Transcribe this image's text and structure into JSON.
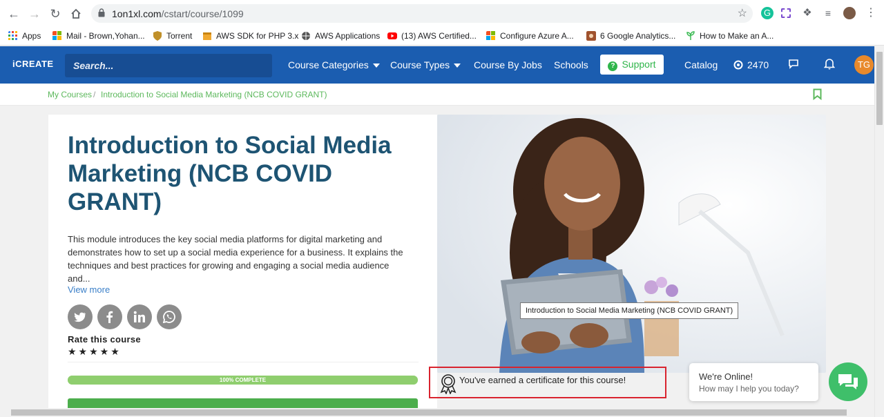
{
  "browser": {
    "url_host": "1on1xl.com",
    "url_path": "/cstart/course/1099",
    "bookmarks": [
      {
        "label": "Apps",
        "icon": "apps-grid-icon",
        "color": "#4285f4"
      },
      {
        "label": "Mail - Brown,Yohan...",
        "icon": "windows-icon",
        "color": "#f25022"
      },
      {
        "label": "Torrent",
        "icon": "shield-icon",
        "color": "#c0902a"
      },
      {
        "label": "AWS SDK for PHP 3.x",
        "icon": "box-icon",
        "color": "#f0a830"
      },
      {
        "label": "AWS Applications",
        "icon": "globe-icon",
        "color": "#555555"
      },
      {
        "label": "(13) AWS Certified...",
        "icon": "youtube-icon",
        "color": "#ff0000"
      },
      {
        "label": "Configure Azure A...",
        "icon": "windows-icon",
        "color": "#f25022"
      },
      {
        "label": "6 Google Analytics...",
        "icon": "site-icon",
        "color": "#a0522d"
      },
      {
        "label": "How to Make an A...",
        "icon": "sprout-icon",
        "color": "#3cba54"
      }
    ]
  },
  "header": {
    "logo": "iCREATE",
    "search_placeholder": "Search...",
    "nav": {
      "course_categories": "Course Categories",
      "course_types": "Course Types",
      "course_by_jobs": "Course By Jobs",
      "schools": "Schools",
      "support": "Support",
      "catalog": "Catalog",
      "points": "2470"
    },
    "avatar_initials": "TG"
  },
  "breadcrumb": {
    "root": "My Courses",
    "separator": "/",
    "current": "Introduction to Social Media Marketing (NCB COVID GRANT)"
  },
  "course": {
    "title": "Introduction to Social Media Marketing (NCB COVID GRANT)",
    "description": "This module introduces the key social media platforms for digital marketing and demonstrates how to set up a social media experience for a business. It explains the techniques and best practices for growing and engaging a social media audience and...",
    "view_more": "View more",
    "rate_label": "Rate this course",
    "stars": "★★★★★",
    "progress_label": "100% COMPLETE",
    "progress_fraction": 1.0,
    "image_tooltip": "Introduction to Social Media Marketing (NCB COVID GRANT)",
    "certificate_text": "You've earned a certificate for this course!"
  },
  "chat": {
    "title": "We're Online!",
    "subtitle": "How may I help you today?"
  },
  "colors": {
    "header_blue": "#1b5db0",
    "title_blue": "#1e5473",
    "green": "#4cae4c",
    "highlight_red": "#d9232e"
  }
}
